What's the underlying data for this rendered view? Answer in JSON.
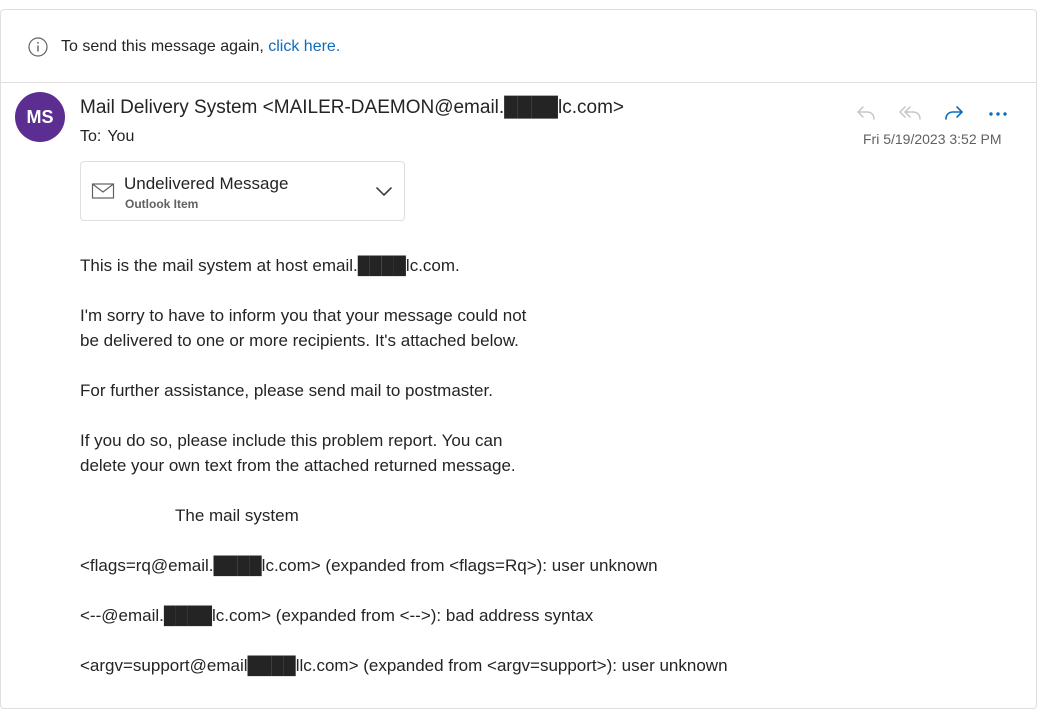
{
  "banner": {
    "text": "To send this message again,",
    "link": "click here."
  },
  "avatar": {
    "initials": "MS",
    "color": "#5c2e91"
  },
  "sender": "Mail Delivery System <MAILER-DAEMON@email.████lc.com>",
  "to": {
    "label": "To:",
    "value": "You"
  },
  "timestamp": "Fri 5/19/2023 3:52 PM",
  "actions": {
    "icons": [
      "reply-icon",
      "reply-all-icon",
      "forward-icon",
      "more-icon"
    ],
    "accent": "#0f6cbd"
  },
  "attachment": {
    "name": "Undelivered Message",
    "type": "Outlook Item",
    "icon": "envelope-icon"
  },
  "body": {
    "p1": "This is the mail system at host email.████lc.com.",
    "p2a": "I'm sorry to have to inform you that your message could not",
    "p2b": "be delivered to one or more recipients. It's attached below.",
    "p3": "For further assistance, please send mail to postmaster.",
    "p4a": "If you do so, please include this problem report. You can",
    "p4b": "delete your own text from the attached returned message.",
    "p5": "The mail system",
    "p6": "<flags=rq@email.████lc.com> (expanded from <flags=Rq>): user unknown",
    "p7": "<--@email.████lc.com> (expanded from <-->): bad address syntax",
    "p8": "<argv=support@email████llc.com> (expanded from <argv=support>): user unknown"
  },
  "colors": {
    "link": "#0f6cbd",
    "redaction": "#e0141e",
    "border": "#e1dfdd"
  }
}
